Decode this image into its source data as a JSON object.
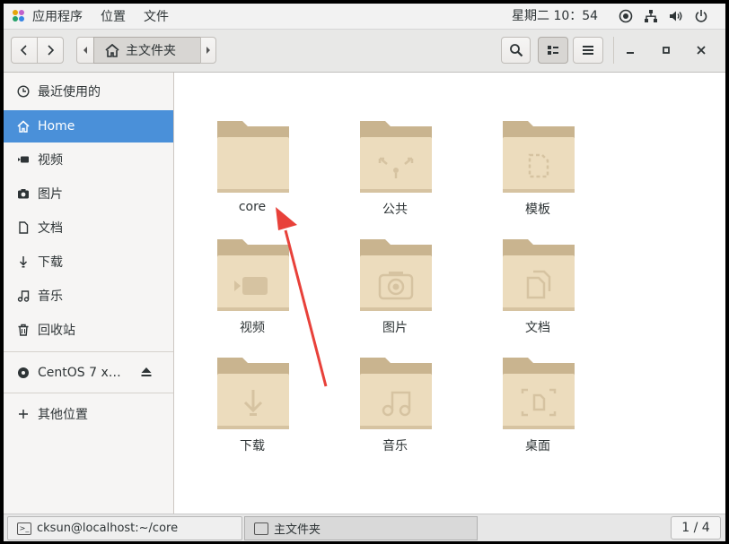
{
  "topbar": {
    "applications": "应用程序",
    "places": "位置",
    "file_menu": "文件",
    "clock": "星期二 10：54"
  },
  "toolbar": {
    "path_label": "主文件夹"
  },
  "sidebar": {
    "items": [
      {
        "label": "最近使用的",
        "icon": "recent-icon"
      },
      {
        "label": "Home",
        "icon": "home-icon"
      },
      {
        "label": "视频",
        "icon": "video-icon"
      },
      {
        "label": "图片",
        "icon": "camera-icon"
      },
      {
        "label": "文档",
        "icon": "document-icon"
      },
      {
        "label": "下载",
        "icon": "download-icon"
      },
      {
        "label": "音乐",
        "icon": "music-icon"
      },
      {
        "label": "回收站",
        "icon": "trash-icon"
      }
    ],
    "device": {
      "label": "CentOS 7 x…",
      "icon": "disc-icon"
    },
    "other": {
      "label": "其他位置",
      "icon": "plus-icon"
    }
  },
  "folders": [
    {
      "label": "core",
      "emblem": "none"
    },
    {
      "label": "公共",
      "emblem": "share"
    },
    {
      "label": "模板",
      "emblem": "template"
    },
    {
      "label": "视频",
      "emblem": "video"
    },
    {
      "label": "图片",
      "emblem": "camera"
    },
    {
      "label": "文档",
      "emblem": "documents"
    },
    {
      "label": "下载",
      "emblem": "download"
    },
    {
      "label": "音乐",
      "emblem": "music"
    },
    {
      "label": "桌面",
      "emblem": "desktop"
    }
  ],
  "taskbar": {
    "terminal_task": "cksun@localhost:~/core",
    "files_task": "主文件夹",
    "pager": "1 / 4"
  },
  "colors": {
    "selection": "#4a90d9",
    "folder_body": "#ecdcbd",
    "folder_tab": "#c9b48f",
    "annotation_arrow": "#e8413a"
  }
}
